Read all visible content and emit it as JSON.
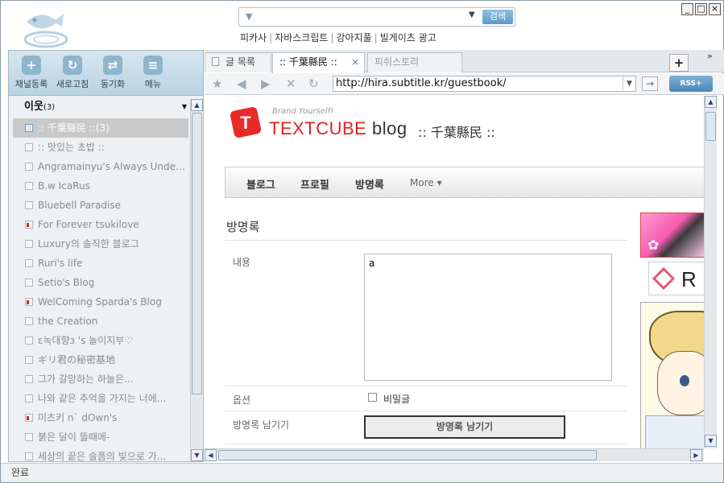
{
  "window": {
    "minimize": "_",
    "maximize": "□",
    "close": "×"
  },
  "search": {
    "button": "검색",
    "links": [
      "피카사",
      "자바스크립트",
      "강아지풀",
      "빌게이츠 광고"
    ]
  },
  "toolbar": {
    "items": [
      {
        "label": "채널등록",
        "icon": "rss-add-icon"
      },
      {
        "label": "새로고침",
        "icon": "refresh-icon"
      },
      {
        "label": "동기화",
        "icon": "sync-icon"
      },
      {
        "label": "메뉴",
        "icon": "menu-icon"
      }
    ]
  },
  "feedlist": {
    "group": "이웃",
    "group_count": "(3)",
    "items": [
      {
        "label": ":: 千葉縣民 ::(3)",
        "selected": true,
        "mark": false
      },
      {
        "label": ":: 맛있는 초밥 ::",
        "selected": false,
        "mark": false
      },
      {
        "label": "Angramainyu's Always Under ...",
        "selected": false,
        "mark": false
      },
      {
        "label": "B.w IcaRus",
        "selected": false,
        "mark": false
      },
      {
        "label": "Bluebell Paradise",
        "selected": false,
        "mark": false
      },
      {
        "label": "For Forever tsukilove",
        "selected": false,
        "mark": true
      },
      {
        "label": "Luxury의 솔직한 블로그",
        "selected": false,
        "mark": false
      },
      {
        "label": "Ruri's life",
        "selected": false,
        "mark": false
      },
      {
        "label": "Setio's Blog",
        "selected": false,
        "mark": false
      },
      {
        "label": "WelComing Sparda's Blog",
        "selected": false,
        "mark": true
      },
      {
        "label": "the Creation",
        "selected": false,
        "mark": false
      },
      {
        "label": "ε녹대향з 's 놀이지부♡",
        "selected": false,
        "mark": false
      },
      {
        "label": "ギリ君の秘密基地",
        "selected": false,
        "mark": false
      },
      {
        "label": "그가 갈망하는 하늘은...",
        "selected": false,
        "mark": false
      },
      {
        "label": "나와 같은 추억을 가지는 너에...",
        "selected": false,
        "mark": false
      },
      {
        "label": "미츠키 n` dOwn's",
        "selected": false,
        "mark": true
      },
      {
        "label": "붉은 달이 뜰때에-",
        "selected": false,
        "mark": false
      },
      {
        "label": "세상의 끝은 슬픔의 빛으로 가...",
        "selected": false,
        "mark": false
      }
    ]
  },
  "tabs": [
    {
      "label": "글 목록",
      "state": "normal"
    },
    {
      "label": ":: 千葉縣民 ::",
      "state": "active"
    },
    {
      "label": "피쉬스토리",
      "state": "inactive"
    }
  ],
  "tabs_more": "»",
  "newtab": "+",
  "nav": {
    "url": "http://hira.subtitle.kr/guestbook/",
    "rss": "RSS+"
  },
  "blog": {
    "brand_tagline": "Brand Yourself!",
    "brand_name": "TEXTCUBE",
    "brand_suffix": "blog",
    "site_title": ":: 千葉縣民 ::",
    "menu": [
      "블로그",
      "프로필",
      "방명록"
    ],
    "menu_more": "More",
    "section_title": "방명록",
    "content_label": "내용",
    "content_value": "a",
    "option_label": "옵션",
    "secret_label": "비밀글",
    "submit_label": "방명록 남기기",
    "submit_button": "방명록 남기기"
  },
  "status": "완료",
  "colors": {
    "accent": "#e02020",
    "rss": "#4a86b9",
    "selected_bg": "#c9c9c9"
  }
}
